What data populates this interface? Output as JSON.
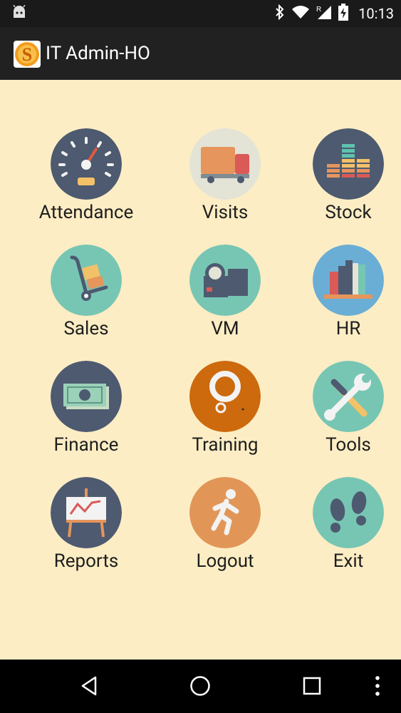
{
  "status_bar": {
    "time": "10:13",
    "icons": [
      "android-debug-icon",
      "bluetooth-icon",
      "wifi-icon",
      "signal-roaming-icon",
      "battery-charging-icon"
    ]
  },
  "action_bar": {
    "title": "IT Admin-HO",
    "logo_icon": "app-logo-icon"
  },
  "menu": [
    {
      "label": "Attendance",
      "icon": "speedometer-icon",
      "color": "#4d5a70"
    },
    {
      "label": "Visits",
      "icon": "truck-icon",
      "color": "#e3e3d6"
    },
    {
      "label": "Stock",
      "icon": "stacked-boxes-icon",
      "color": "#4d5a70"
    },
    {
      "label": "Sales",
      "icon": "hand-truck-icon",
      "color": "#77c6b3"
    },
    {
      "label": "VM",
      "icon": "video-camera-icon",
      "color": "#77c6b3"
    },
    {
      "label": "HR",
      "icon": "books-icon",
      "color": "#6aaed6"
    },
    {
      "label": "Finance",
      "icon": "money-icon",
      "color": "#4d5a70"
    },
    {
      "label": "Training",
      "icon": "thought-bubble-icon",
      "color": "#cc6a0d"
    },
    {
      "label": "Tools",
      "icon": "wrench-screwdriver-icon",
      "color": "#77c6b3"
    },
    {
      "label": "Reports",
      "icon": "easel-chart-icon",
      "color": "#4d5a70"
    },
    {
      "label": "Logout",
      "icon": "running-man-icon",
      "color": "#e19658"
    },
    {
      "label": "Exit",
      "icon": "footprints-icon",
      "color": "#77c6b3"
    }
  ],
  "nav_bar": {
    "icons": [
      "back-icon",
      "home-icon",
      "recents-icon",
      "overflow-menu-icon"
    ]
  },
  "colors": {
    "background": "#fdedc4",
    "status_bar": "#1a1a1a",
    "action_bar": "#212121",
    "nav_bar": "#000000"
  }
}
